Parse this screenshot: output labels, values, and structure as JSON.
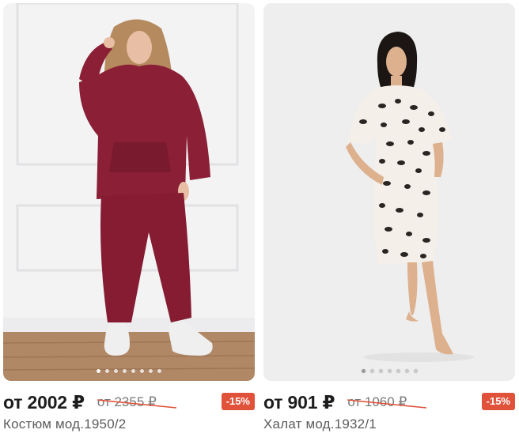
{
  "products": [
    {
      "price_from": "от 2002 ₽",
      "old_price": "от 2355 ₽",
      "discount": "-15%",
      "name": "Костюм мод.1950/2",
      "slides": 8,
      "active_slide": 1,
      "colors": {
        "background": "#f3f3f4",
        "floor": "#b18866",
        "garment": "#8a1f35",
        "sneakers": "#efefef",
        "skin": "#e8bfa5",
        "hair": "#b48a5e"
      }
    },
    {
      "price_from": "от 901 ₽",
      "old_price": "от 1060 ₽",
      "discount": "-15%",
      "name": "Халат мод.1932/1",
      "slides": 7,
      "active_slide": 1,
      "colors": {
        "background": "#eeeeee",
        "garment": "#f4efe8",
        "pattern": "#2a2522",
        "skin": "#ddb08e",
        "hair": "#1b1614"
      }
    }
  ],
  "accent": "#e0523a"
}
